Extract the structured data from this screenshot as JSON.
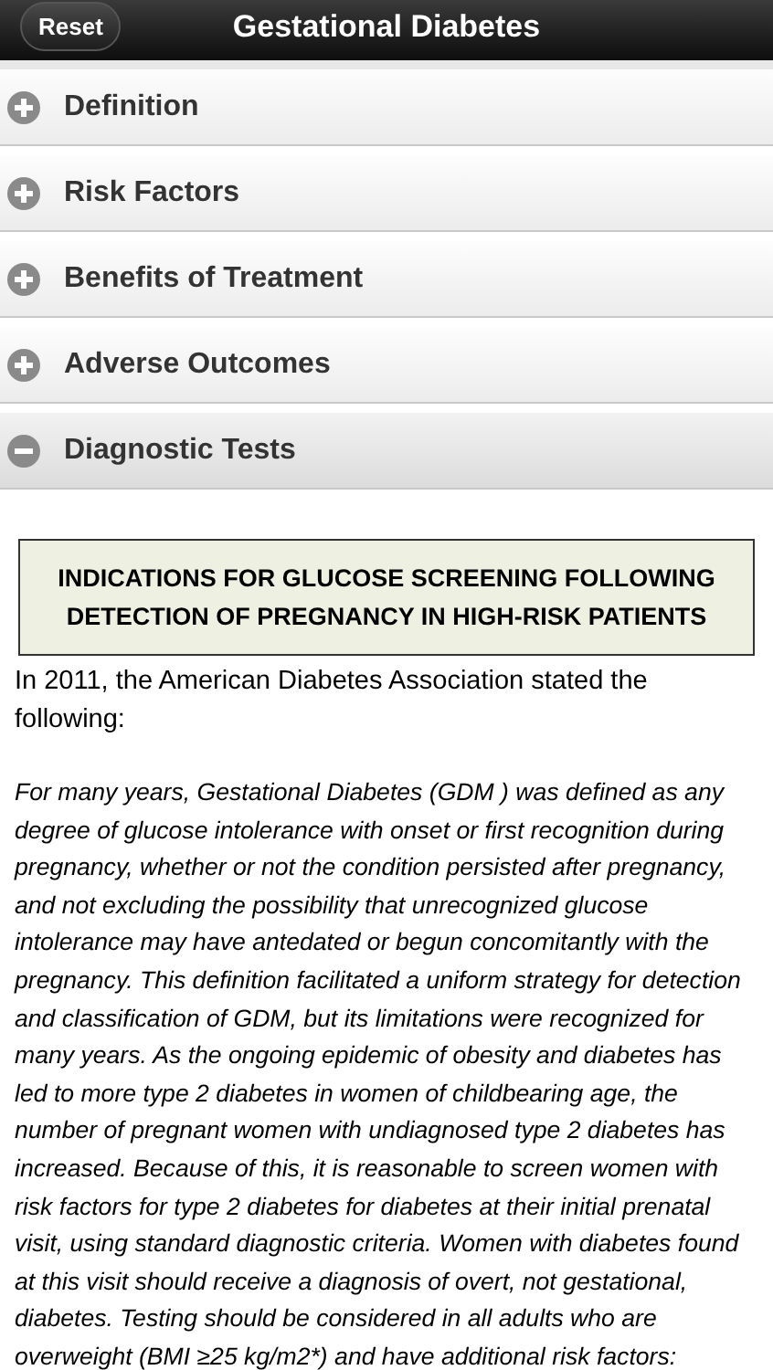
{
  "header": {
    "reset_button": "Reset",
    "title": "Gestational Diabetes"
  },
  "sections": [
    {
      "label": "Definition",
      "expanded": false
    },
    {
      "label": "Risk Factors",
      "expanded": false
    },
    {
      "label": "Benefits of Treatment",
      "expanded": false
    },
    {
      "label": "Adverse Outcomes",
      "expanded": false
    },
    {
      "label": "Diagnostic Tests",
      "expanded": true
    }
  ],
  "content": {
    "heading": "INDICATIONS FOR GLUCOSE SCREENING FOLLOWING DETECTION OF PREGNANCY IN HIGH-RISK PATIENTS",
    "intro": "In 2011, the American Diabetes Association stated the following:",
    "quote": "For many years, Gestational Diabetes (GDM ) was defined as any degree of glucose intolerance with onset or first recognition during pregnancy, whether or not the condition persisted after pregnancy, and not excluding the possibility that unrecognized glucose intolerance may have antedated or begun concomitantly with the pregnancy. This definition facilitated a uniform strategy for detection and classification of GDM, but its limitations were recognized for many years. As the ongoing epidemic of obesity and diabetes has led to more type 2 diabetes in women of childbearing age, the number of pregnant women with undiagnosed type 2 diabetes has increased. Because of this, it is reasonable to screen women with risk factors for type 2 diabetes for diabetes at their initial prenatal visit, using standard diagnostic criteria. Women with diabetes found at this visit should receive a diagnosis of overt, not gestational, diabetes. Testing should be considered in all adults who are overweight (BMI ≥25 kg/m2*) and have additional risk factors:"
  }
}
